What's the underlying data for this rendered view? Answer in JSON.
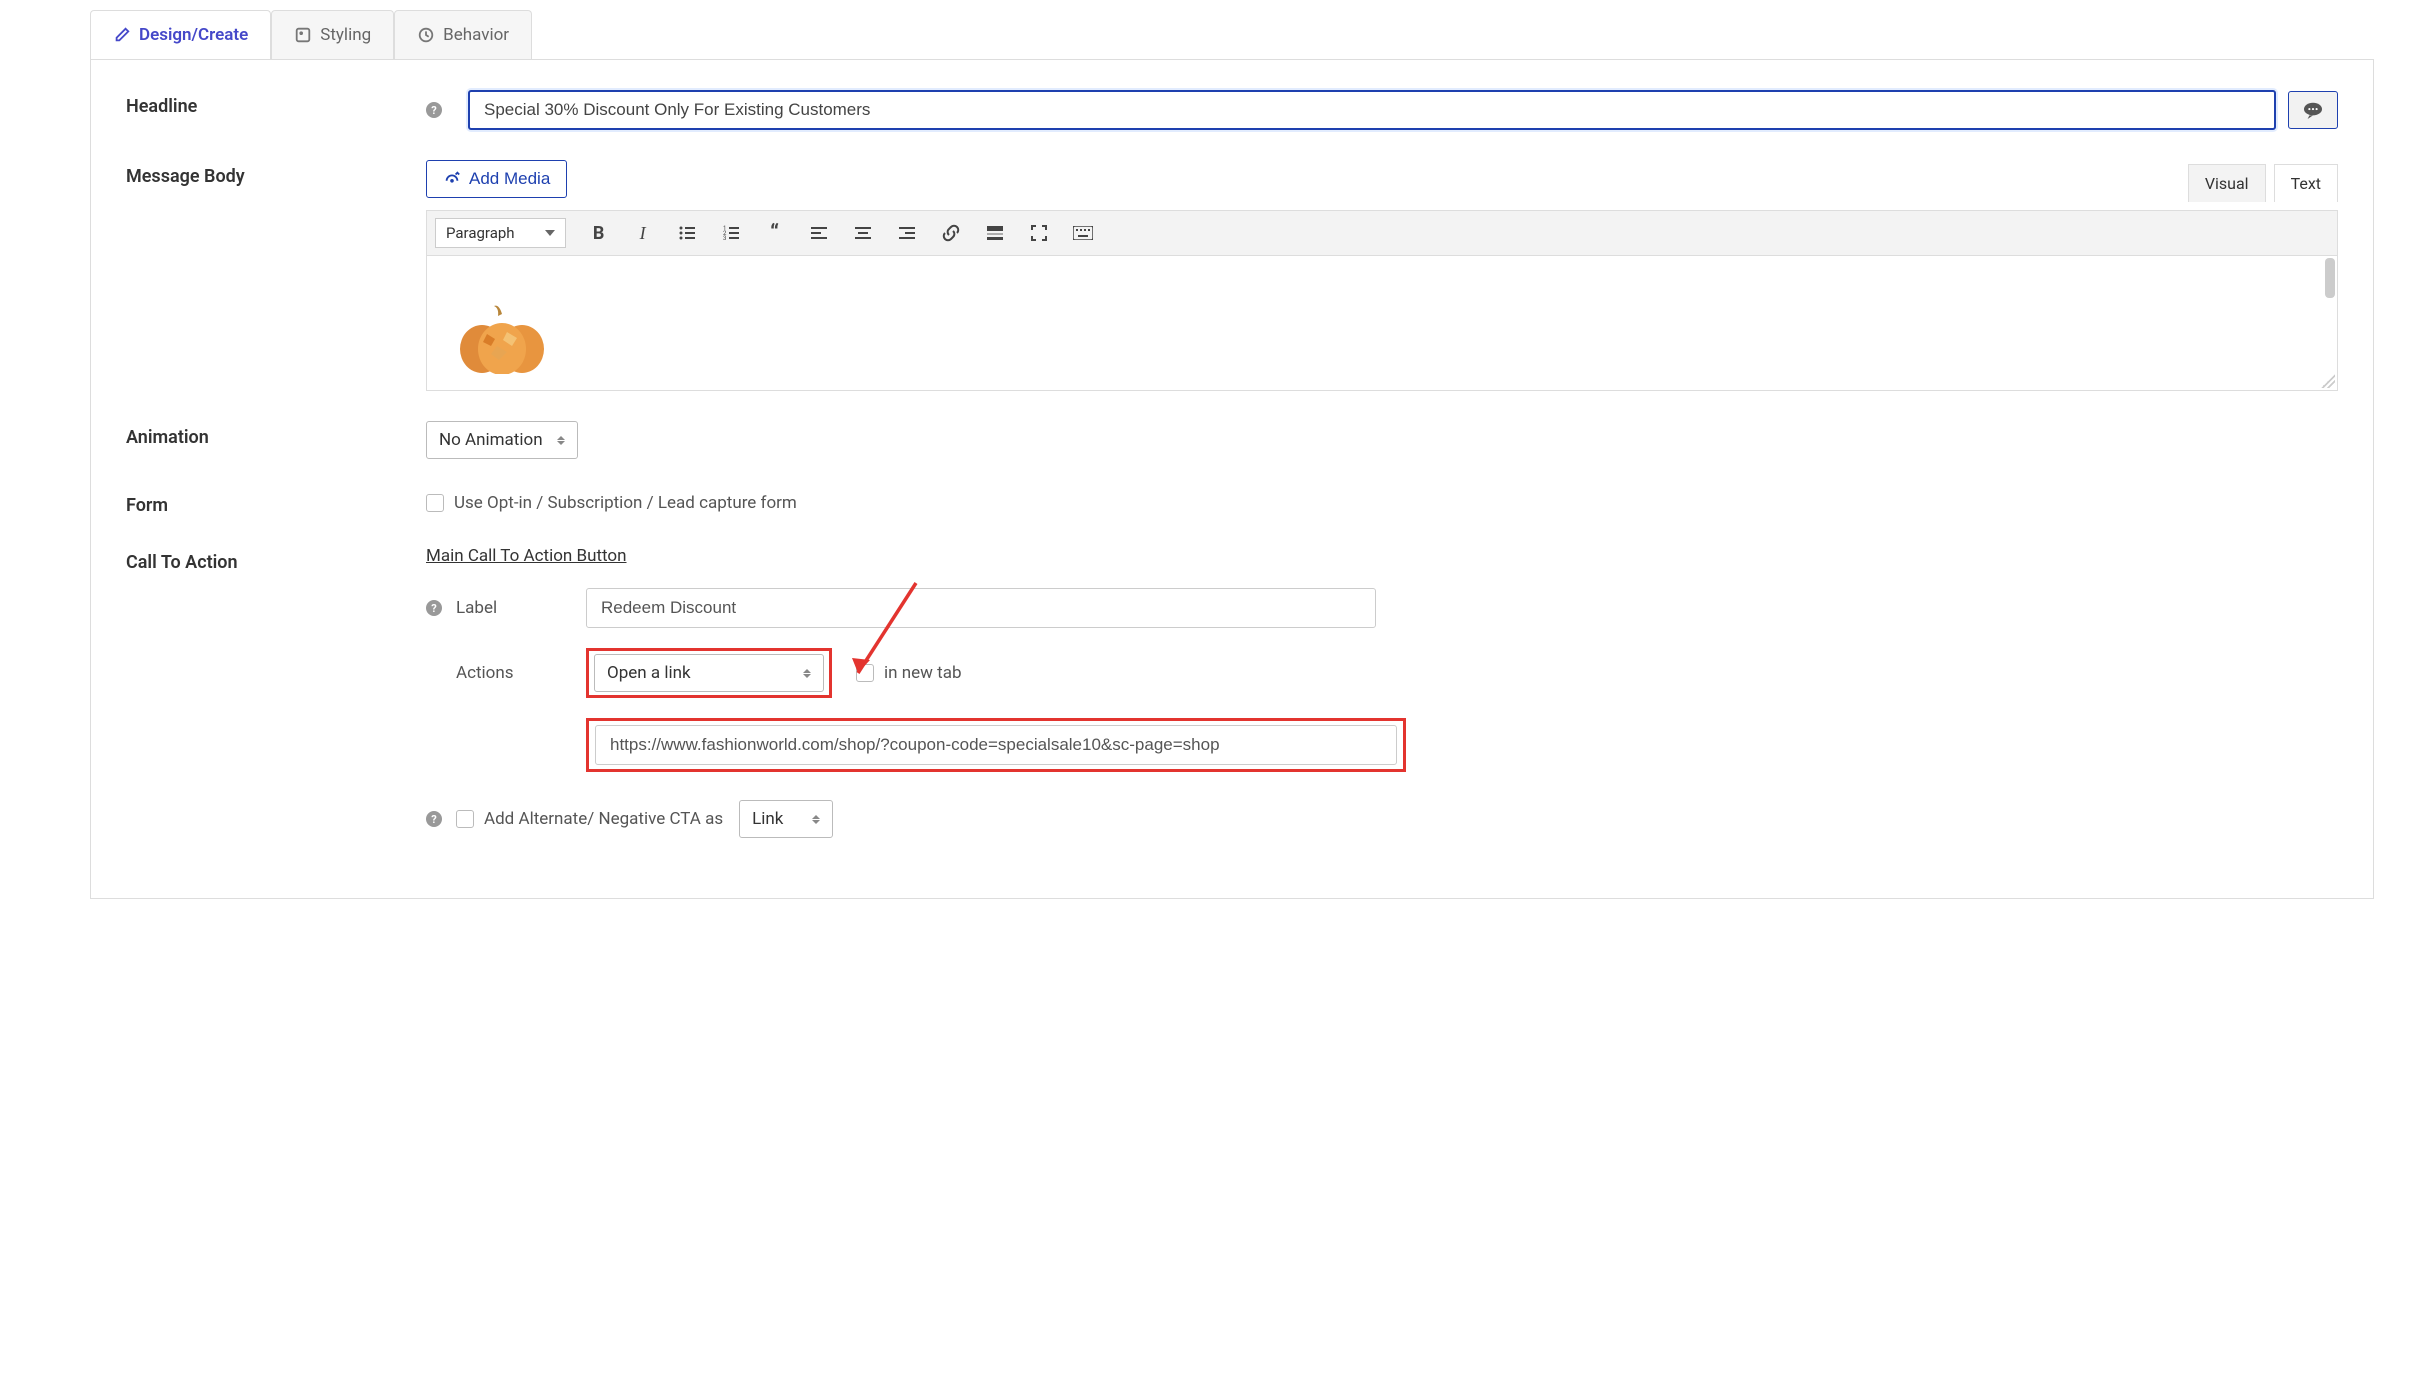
{
  "tabs": {
    "design": "Design/Create",
    "styling": "Styling",
    "behavior": "Behavior"
  },
  "labels": {
    "headline": "Headline",
    "message_body": "Message Body",
    "animation": "Animation",
    "form": "Form",
    "cta": "Call To Action"
  },
  "headline": {
    "value": "Special 30% Discount Only For Existing Customers"
  },
  "message_body": {
    "add_media": "Add Media",
    "editor_tabs": {
      "visual": "Visual",
      "text": "Text"
    },
    "para_label": "Paragraph"
  },
  "animation": {
    "value": "No Animation"
  },
  "form": {
    "checkbox_label": "Use Opt-in / Subscription / Lead capture form"
  },
  "cta": {
    "section_title": "Main Call To Action Button",
    "label_label": "Label",
    "label_value": "Redeem Discount",
    "actions_label": "Actions",
    "actions_value": "Open a link",
    "new_tab_label": "in new tab",
    "url_value": "https://www.fashionworld.com/shop/?coupon-code=specialsale10&sc-page=shop",
    "alt_cta_label": "Add Alternate/ Negative CTA as",
    "alt_cta_select": "Link"
  }
}
